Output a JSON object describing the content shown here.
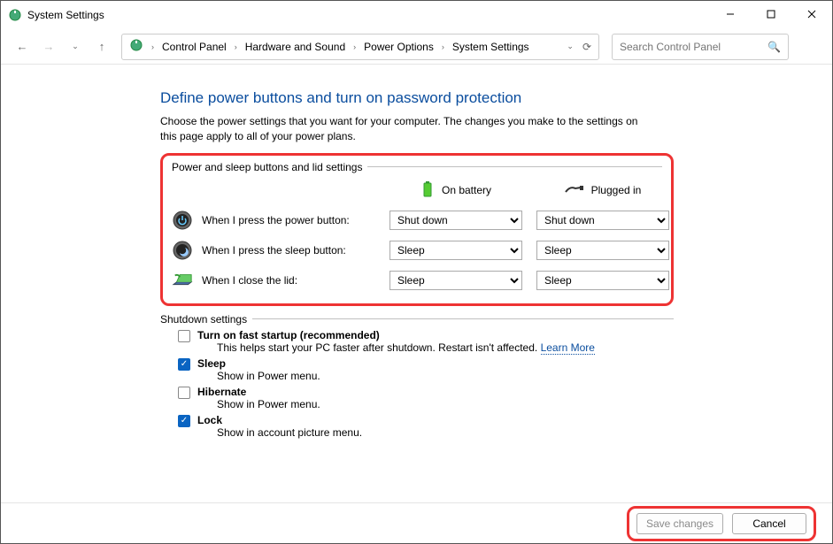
{
  "window": {
    "title": "System Settings"
  },
  "breadcrumb": [
    "Control Panel",
    "Hardware and Sound",
    "Power Options",
    "System Settings"
  ],
  "search": {
    "placeholder": "Search Control Panel"
  },
  "page": {
    "title": "Define power buttons and turn on password protection",
    "desc": "Choose the power settings that you want for your computer. The changes you make to the settings on this page apply to all of your power plans."
  },
  "group1": {
    "legend": "Power and sleep buttons and lid settings",
    "col_battery": "On battery",
    "col_plugged": "Plugged in",
    "rows": [
      {
        "label": "When I press the power button:",
        "battery": "Shut down",
        "plugged": "Shut down"
      },
      {
        "label": "When I press the sleep button:",
        "battery": "Sleep",
        "plugged": "Sleep"
      },
      {
        "label": "When I close the lid:",
        "battery": "Sleep",
        "plugged": "Sleep"
      }
    ]
  },
  "group2": {
    "legend": "Shutdown settings",
    "items": [
      {
        "label": "Turn on fast startup (recommended)",
        "checked": false,
        "sub": "This helps start your PC faster after shutdown. Restart isn't affected.",
        "link": "Learn More"
      },
      {
        "label": "Sleep",
        "checked": true,
        "sub": "Show in Power menu."
      },
      {
        "label": "Hibernate",
        "checked": false,
        "sub": "Show in Power menu."
      },
      {
        "label": "Lock",
        "checked": true,
        "sub": "Show in account picture menu."
      }
    ]
  },
  "footer": {
    "save": "Save changes",
    "cancel": "Cancel"
  }
}
